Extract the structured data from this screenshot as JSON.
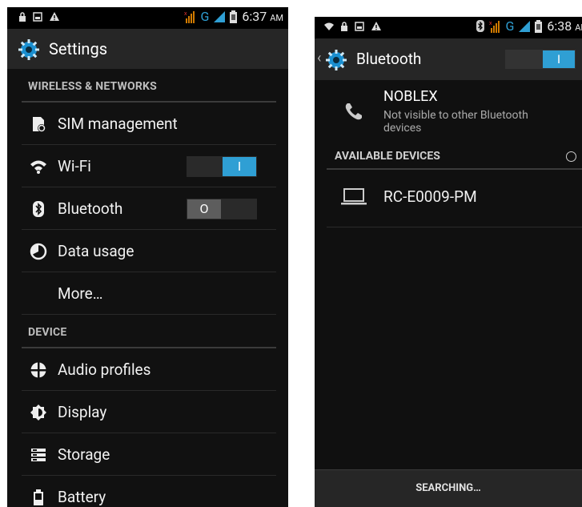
{
  "left_screen": {
    "status": {
      "time": "6:37",
      "ampm": "AM",
      "network": "G"
    },
    "title": "Settings",
    "sections": [
      {
        "header": "WIRELESS & NETWORKS",
        "items": [
          {
            "label": "SIM management",
            "icon": "sim-icon"
          },
          {
            "label": "Wi-Fi",
            "icon": "wifi-icon",
            "toggle": "on",
            "toggle_text": "I"
          },
          {
            "label": "Bluetooth",
            "icon": "bluetooth-icon",
            "toggle": "off",
            "toggle_text": "O"
          },
          {
            "label": "Data usage",
            "icon": "data-usage-icon"
          },
          {
            "label": "More…"
          }
        ]
      },
      {
        "header": "DEVICE",
        "items": [
          {
            "label": "Audio profiles",
            "icon": "audio-profiles-icon"
          },
          {
            "label": "Display",
            "icon": "display-icon"
          },
          {
            "label": "Storage",
            "icon": "storage-icon"
          },
          {
            "label": "Battery",
            "icon": "battery-icon"
          }
        ]
      }
    ]
  },
  "right_screen": {
    "status": {
      "time": "6:38",
      "ampm": "AM",
      "network": "G"
    },
    "title": "Bluetooth",
    "toggle_text": "I",
    "this_device": {
      "name": "NOBLEX",
      "visibility": "Not visible to other Bluetooth devices"
    },
    "available_header": "AVAILABLE DEVICES",
    "available_devices": [
      {
        "name": "RC-E0009-PM",
        "icon": "laptop-icon"
      }
    ],
    "footer": "SEARCHING…"
  },
  "colors": {
    "accent": "#2f9fd4",
    "background": "#111111",
    "actionbar": "#262626"
  }
}
